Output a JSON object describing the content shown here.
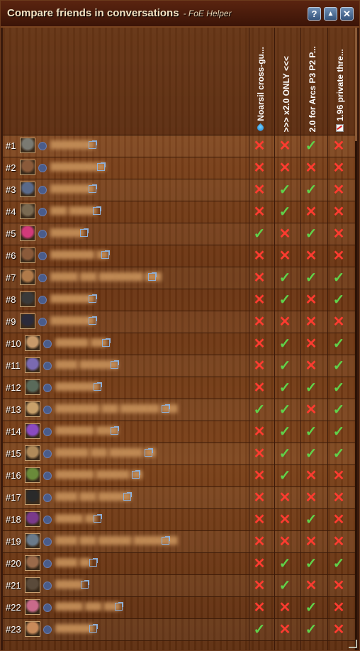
{
  "window": {
    "title": "Compare friends in conversations",
    "subtitle": "- FoE Helper",
    "help_label": "?",
    "minimize_label": "▲",
    "close_label": "✕"
  },
  "columns": [
    {
      "label": "Noarsil cross-gu...",
      "icon": "water-drop-icon"
    },
    {
      "label": ">>> x2.0 ONLY <<<",
      "icon": ""
    },
    {
      "label": "2.0 for Arcs P3 P2 P...",
      "icon": ""
    },
    {
      "label": "1.96 private thre...",
      "icon": "chart-icon"
    }
  ],
  "marks": {
    "yes": "✓",
    "no": "✕"
  },
  "colors": {
    "yes": "#5fd24a",
    "no": "#ff3b30"
  },
  "rows": [
    {
      "rank": "#1",
      "name": "████████",
      "avatar_color": "#7a7a72",
      "vals": [
        false,
        false,
        true,
        false
      ]
    },
    {
      "rank": "#2",
      "name": "██████████",
      "avatar_color": "#8a5a3a",
      "vals": [
        false,
        false,
        false,
        false
      ]
    },
    {
      "rank": "#3",
      "name": "████████",
      "avatar_color": "#5a6a8a",
      "vals": [
        false,
        true,
        true,
        false
      ]
    },
    {
      "rank": "#4",
      "name": "███ █████",
      "avatar_color": "#7a6a52",
      "vals": [
        false,
        true,
        false,
        false
      ]
    },
    {
      "rank": "#5",
      "name": "██████",
      "avatar_color": "#d23a7a",
      "vals": [
        true,
        false,
        true,
        false
      ]
    },
    {
      "rank": "#6",
      "name": "████████ ██",
      "avatar_color": "#8a5a3a",
      "vals": [
        false,
        false,
        false,
        false
      ]
    },
    {
      "rank": "#7",
      "name": "█████ ███ ████████ ███",
      "avatar_color": "#b07a4a",
      "vals": [
        false,
        true,
        true,
        true
      ]
    },
    {
      "rank": "#8",
      "name": "████████",
      "avatar_color": "#3a3a3a",
      "vals": [
        false,
        true,
        false,
        true
      ]
    },
    {
      "rank": "#9",
      "name": "████████",
      "avatar_color": "#2a2a3a",
      "vals": [
        false,
        false,
        false,
        false
      ]
    },
    {
      "rank": "#10",
      "name": "██████ ███",
      "avatar_color": "#c89a6a",
      "vals": [
        false,
        true,
        false,
        true
      ]
    },
    {
      "rank": "#11",
      "name": "████ ███████",
      "avatar_color": "#7a6ab0",
      "vals": [
        false,
        true,
        false,
        true
      ]
    },
    {
      "rank": "#12",
      "name": "████████",
      "avatar_color": "#5a6a5a",
      "vals": [
        false,
        true,
        true,
        true
      ]
    },
    {
      "rank": "#13",
      "name": "████████ ███ ███████ ███",
      "avatar_color": "#c8a06a",
      "vals": [
        true,
        true,
        false,
        true
      ]
    },
    {
      "rank": "#14",
      "name": "███████ ████",
      "avatar_color": "#8a4ac0",
      "vals": [
        false,
        true,
        true,
        true
      ]
    },
    {
      "rank": "#15",
      "name": "██████ ███ ██████ ██",
      "avatar_color": "#b08a5a",
      "vals": [
        false,
        true,
        true,
        true
      ]
    },
    {
      "rank": "#16",
      "name": "███████ ██████ ██",
      "avatar_color": "#6a8a3a",
      "vals": [
        false,
        true,
        false,
        false
      ]
    },
    {
      "rank": "#17",
      "name": "████ ███ ██████",
      "avatar_color": "#2a2a2a",
      "vals": [
        false,
        false,
        false,
        false
      ]
    },
    {
      "rank": "#18",
      "name": "█████ ██",
      "avatar_color": "#7a3a8a",
      "vals": [
        false,
        false,
        true,
        false
      ]
    },
    {
      "rank": "#19",
      "name": "████ ███ ██████ ████████",
      "avatar_color": "#6a7a8a",
      "vals": [
        false,
        false,
        false,
        false
      ]
    },
    {
      "rank": "#20",
      "name": "████ ██",
      "avatar_color": "#9a6a4a",
      "vals": [
        false,
        true,
        true,
        true
      ]
    },
    {
      "rank": "#21",
      "name": "█████",
      "avatar_color": "#5a4a3a",
      "vals": [
        false,
        true,
        false,
        false
      ]
    },
    {
      "rank": "#22",
      "name": "█████ ███ ███",
      "avatar_color": "#c86a8a",
      "vals": [
        false,
        false,
        true,
        false
      ]
    },
    {
      "rank": "#23",
      "name": "███████",
      "avatar_color": "#c88a5a",
      "vals": [
        true,
        false,
        true,
        false
      ]
    }
  ]
}
